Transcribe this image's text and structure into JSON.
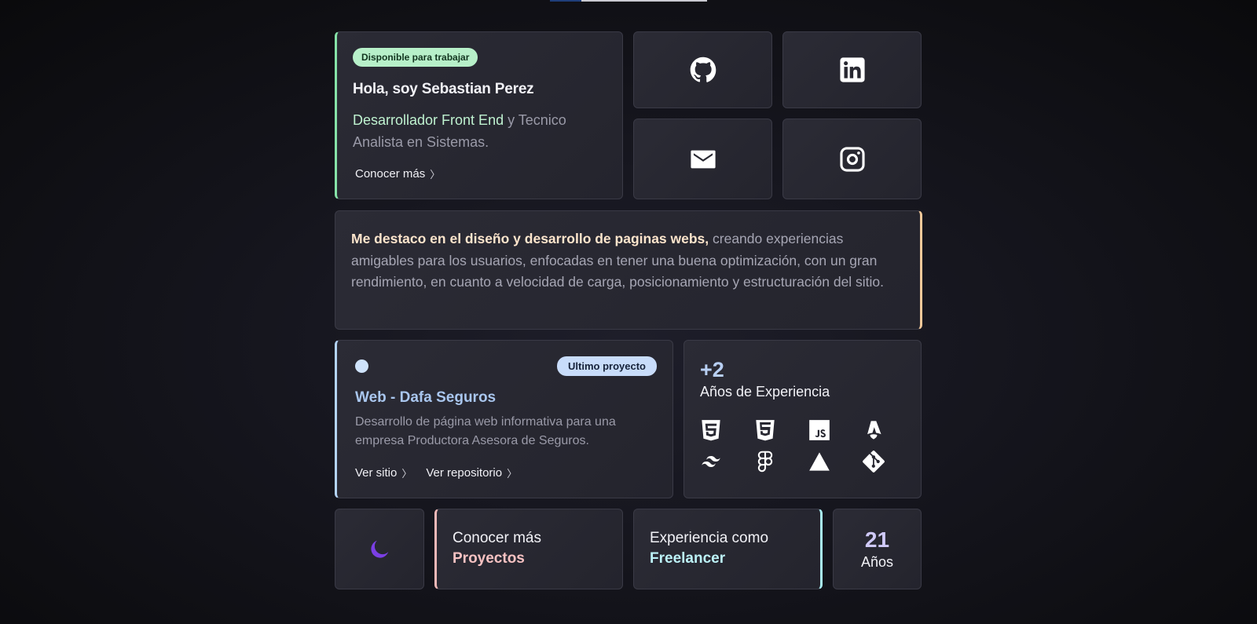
{
  "hero": {
    "badge": "Disponible para trabajar",
    "title": "Hola, soy Sebastian Perez",
    "role_highlight": "Desarrollador Front End",
    "role_rest": " y Tecnico Analista en Sistemas.",
    "link": "Conocer más"
  },
  "social": [
    "github-icon",
    "linkedin-icon",
    "mail-icon",
    "instagram-icon"
  ],
  "about": {
    "strong": "Me destaco en el diseño y desarrollo de paginas webs,",
    "rest": " creando experiencias amigables para los usuarios, enfocadas en tener una buena optimización, con un gran rendimiento, en cuanto a velocidad de carga, posicionamiento y estructuración del sitio."
  },
  "project": {
    "badge": "Ultimo proyecto",
    "title": "Web - Dafa Seguros",
    "description": "Desarrollo de página web informativa para una empresa Productora Asesora de Seguros.",
    "link_site": "Ver sitio",
    "link_repo": "Ver repositorio"
  },
  "experience": {
    "years": "+2",
    "label": "Años de Experiencia",
    "skills": [
      "html5-icon",
      "css3-icon",
      "javascript-icon",
      "astro-icon",
      "tailwind-icon",
      "figma-icon",
      "vercel-icon",
      "git-icon"
    ]
  },
  "bottom": {
    "projects_line1": "Conocer más",
    "projects_line2": "Proyectos",
    "freelance_line1": "Experiencia como",
    "freelance_line2": "Freelancer",
    "age_num": "21",
    "age_label": "Años"
  },
  "colors": {
    "accent_green": "#86e3a8",
    "accent_peach": "#f3c99a",
    "accent_blue": "#b4d4f7",
    "accent_pink": "#f4b9b9",
    "accent_cyan": "#a9eef3",
    "moon_purple": "#7b3fe4"
  }
}
